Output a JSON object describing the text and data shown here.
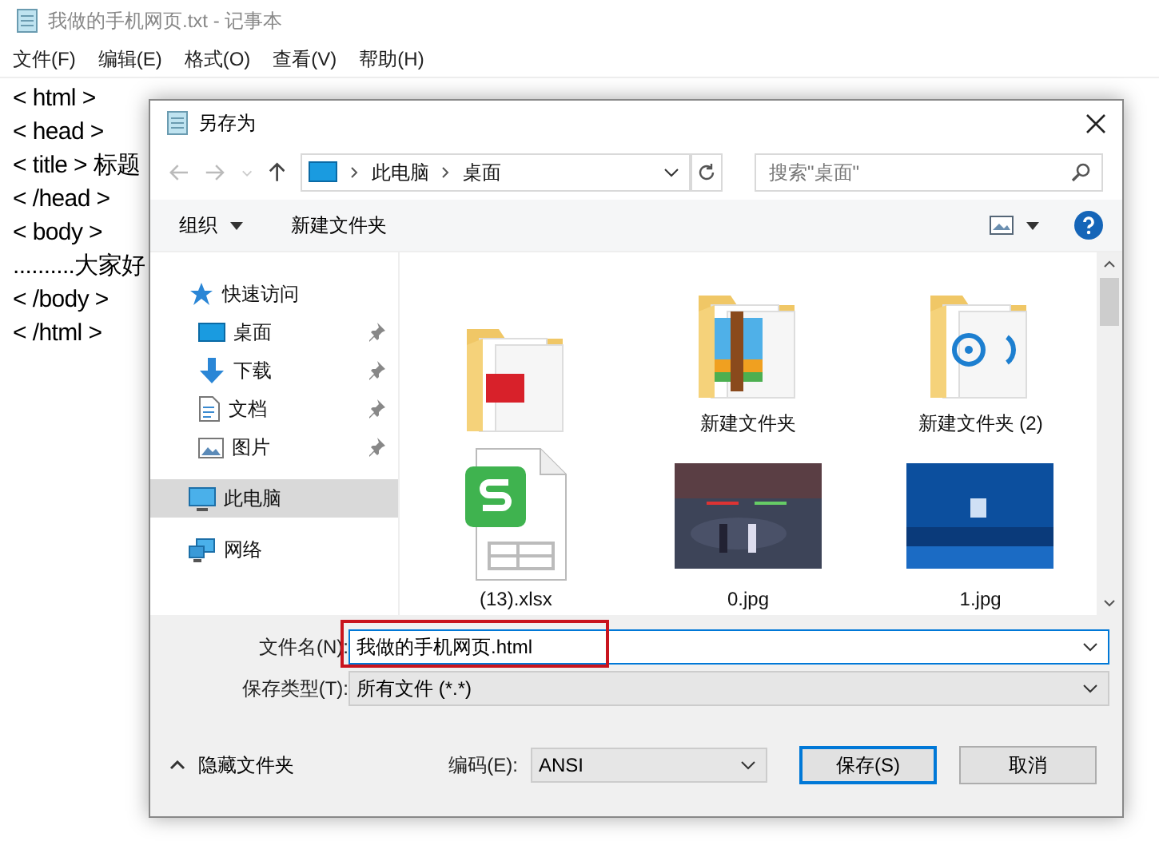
{
  "notepad": {
    "title": "我做的手机网页.txt - 记事本",
    "menu": [
      "文件(F)",
      "编辑(E)",
      "格式(O)",
      "查看(V)",
      "帮助(H)"
    ],
    "lines": [
      "< html >",
      "< head >",
      "< title > 标题",
      "< /head >",
      "< body >",
      "..........大家好",
      "< /body >",
      "< /html >"
    ]
  },
  "dialog": {
    "title": "另存为",
    "breadcrumb": [
      "此电脑",
      "桌面"
    ],
    "search": {
      "placeholder": "搜索\"桌面\""
    },
    "toolbar": [
      "组织",
      "新建文件夹"
    ],
    "nav": [
      {
        "label": "快速访问",
        "kind": "star",
        "selected": false,
        "children": [
          {
            "label": "桌面",
            "kind": "desktop",
            "pinned": true,
            "selected": false
          },
          {
            "label": "下载",
            "kind": "download",
            "pinned": true,
            "selected": false
          },
          {
            "label": "文档",
            "kind": "document",
            "pinned": true,
            "selected": false
          },
          {
            "label": "图片",
            "kind": "pictures",
            "pinned": true,
            "selected": false
          }
        ]
      },
      {
        "label": "此电脑",
        "kind": "pc",
        "selected": true
      },
      {
        "label": "网络",
        "kind": "network",
        "selected": false
      }
    ],
    "files": [
      {
        "kind": "folder-pdf"
      },
      {
        "kind": "folder-archive",
        "name": "新建文件夹"
      },
      {
        "kind": "folder-disc",
        "name": "新建文件夹 (2)"
      },
      {
        "kind": "spreadsheet",
        "name": "(13).xlsx"
      },
      {
        "kind": "picture",
        "name": "0.jpg"
      },
      {
        "kind": "picture",
        "name": "1.jpg"
      }
    ],
    "filename": {
      "label": "文件名(N):",
      "value": "我做的手机网页.html",
      "highlighted": true
    },
    "filetype": {
      "label": "保存类型(T):",
      "value": "所有文件 (*.*)"
    },
    "hide_folders": "隐藏文件夹",
    "encoding": {
      "label": "编码(E):",
      "value": "ANSI"
    },
    "buttons": [
      "保存(S)",
      "取消"
    ]
  }
}
